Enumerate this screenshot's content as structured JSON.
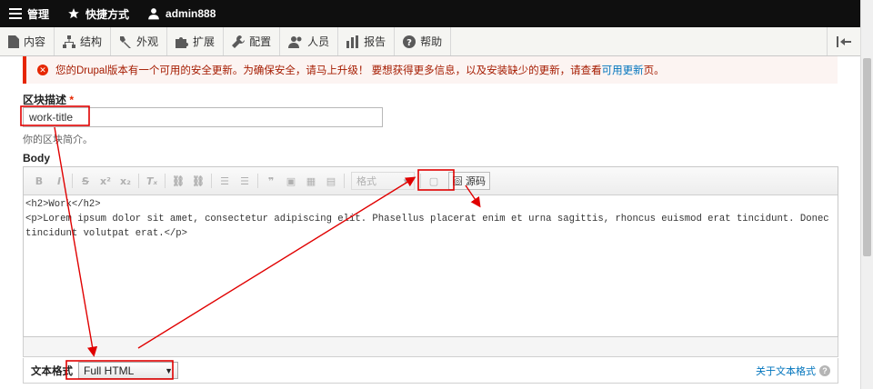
{
  "topbar": {
    "manage_label": "管理",
    "shortcuts_label": "快捷方式",
    "user_label": "admin888"
  },
  "menu": [
    {
      "label": "内容",
      "icon": "content-icon"
    },
    {
      "label": "结构",
      "icon": "structure-icon"
    },
    {
      "label": "外观",
      "icon": "appearance-icon"
    },
    {
      "label": "扩展",
      "icon": "extend-icon"
    },
    {
      "label": "配置",
      "icon": "config-icon"
    },
    {
      "label": "人员",
      "icon": "people-icon"
    },
    {
      "label": "报告",
      "icon": "reports-icon"
    },
    {
      "label": "帮助",
      "icon": "help-icon"
    }
  ],
  "alert": {
    "text": "您的Drupal版本有一个可用的安全更新。为确保安全，请马上升级！ 要想获得更多信息，以及安装缺少的更新，请查看",
    "link": "可用更新",
    "suffix": "页。"
  },
  "block_description": {
    "label": "区块描述",
    "required_mark": "*",
    "value": "work-title",
    "help": "你的区块简介。"
  },
  "body": {
    "label": "Body",
    "format_placeholder": "格式",
    "source_label": "源码",
    "code": "<h2>Work</h2>\n<p>Lorem ipsum dolor sit amet, consectetur adipiscing elit. Phasellus placerat enim et urna sagittis, rhoncus euismod erat tincidunt. Donec tincidunt volutpat erat.</p>"
  },
  "text_format": {
    "label": "文本格式",
    "selected": "Full HTML",
    "about_link": "关于文本格式"
  },
  "colors": {
    "annotation": "#e00000",
    "link": "#0074bd",
    "error": "#e62600"
  }
}
